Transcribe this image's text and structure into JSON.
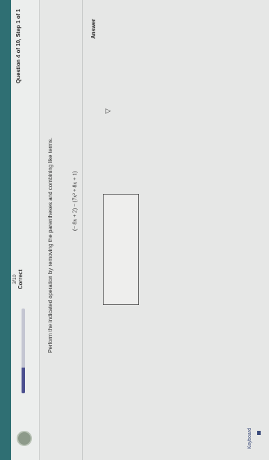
{
  "topbar": {
    "text": ""
  },
  "header": {
    "question_label": "Question 4 of 10, Step 1 of 1",
    "score_fraction": "3/10",
    "score_label": "Correct",
    "progress": 0.3
  },
  "main": {
    "instruction": "Perform the indicated operation by removing the parentheses and combining like terms.",
    "expression": "(− 8x + 2) − (7x² + 8x + 1)",
    "answer_label": "Answer",
    "answer_value": ""
  },
  "footer": {
    "keyboard_label": "Keyboard"
  }
}
